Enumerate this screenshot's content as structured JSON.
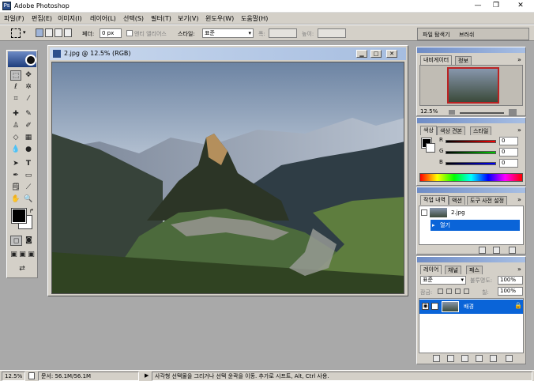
{
  "window": {
    "title": "Adobe Photoshop",
    "controls": [
      "—",
      "❐",
      "✕"
    ]
  },
  "menu": [
    "파일(F)",
    "편집(E)",
    "이미지(I)",
    "레이어(L)",
    "선택(S)",
    "필터(T)",
    "보기(V)",
    "윈도우(W)",
    "도움말(H)"
  ],
  "options": {
    "feather_label": "페더:",
    "feather_value": "0 px",
    "antialias_label": "앤티 앨리어스",
    "style_label": "스타일:",
    "style_value": "표준",
    "width_label": "폭:",
    "height_label": "높이:",
    "palette_tabs": [
      "파일 탐색기",
      "브러쉬"
    ]
  },
  "document": {
    "title": "2.jpg @ 12.5% (RGB)"
  },
  "navigator": {
    "tabs": [
      "내비게이터",
      "정보"
    ],
    "zoom": "12.5%"
  },
  "color_panel": {
    "tabs": [
      "색상",
      "색상 견본",
      "스타일"
    ],
    "channels": [
      {
        "label": "R",
        "value": "0"
      },
      {
        "label": "G",
        "value": "0"
      },
      {
        "label": "B",
        "value": "0"
      }
    ]
  },
  "history_panel": {
    "tabs": [
      "작업 내역",
      "액션",
      "도구 사전 설정"
    ],
    "snapshot": "2.jpg",
    "items": [
      "열기"
    ]
  },
  "layers_panel": {
    "tabs": [
      "레이어",
      "채널",
      "패스"
    ],
    "blend_mode": "표준",
    "opacity_label": "불투명도:",
    "opacity_value": "100%",
    "lock_label": "잠금:",
    "fill_label": "칠:",
    "fill_value": "100%",
    "layers": [
      {
        "name": "배경"
      }
    ]
  },
  "status": {
    "zoom": "12.5%",
    "doc_info": "문서: 56.1M/56.1M",
    "hint": "사각형 선택물을 그리거나 선택 윤곽을 이동. 추가로 시프트, Alt, Ctrl 사용."
  },
  "colors": {
    "accent": "#0a64d8",
    "panel_bg": "#d4d0c8",
    "app_bg": "#a9a9a9"
  }
}
